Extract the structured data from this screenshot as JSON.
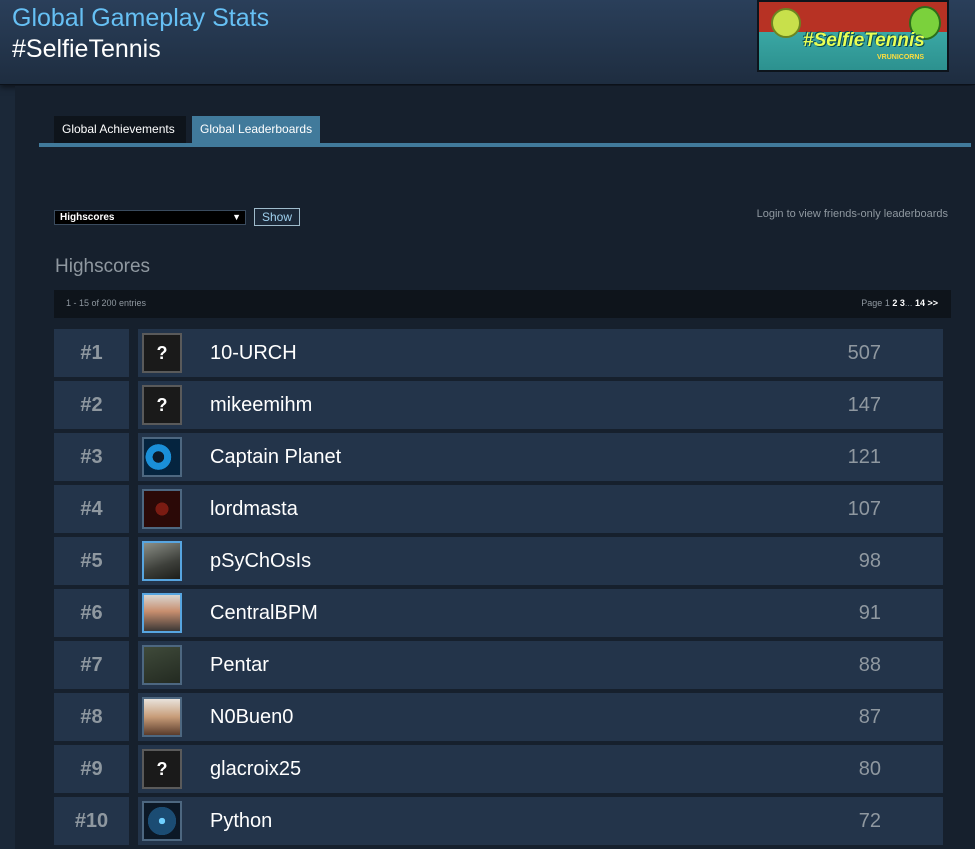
{
  "header": {
    "title": "Global Gameplay Stats",
    "subtitle": "#SelfieTennis",
    "banner": {
      "logo_text": "#SelfieTennis",
      "logo_small": "VRUNICORNS"
    }
  },
  "tabs": [
    {
      "label": "Global Achievements",
      "active": false
    },
    {
      "label": "Global Leaderboards",
      "active": true
    }
  ],
  "controls": {
    "leaderboard_select": "Highscores",
    "show_label": "Show",
    "login_note": "Login to view friends-only leaderboards"
  },
  "leaderboard": {
    "title": "Highscores",
    "entries_text": "1 - 15 of 200 entries",
    "paging": {
      "prefix": "Page",
      "current": "1",
      "pages": [
        "2",
        "3"
      ],
      "ellipsis": "...",
      "last": "14",
      "next": ">>"
    },
    "rows": [
      {
        "rank": "#1",
        "name": "10-URCH",
        "score": "507",
        "avatar": "question-mark-icon"
      },
      {
        "rank": "#2",
        "name": "mikeemihm",
        "score": "147",
        "avatar": "question-mark-icon"
      },
      {
        "rank": "#3",
        "name": "Captain Planet",
        "score": "121",
        "avatar": "planet-avatar"
      },
      {
        "rank": "#4",
        "name": "lordmasta",
        "score": "107",
        "avatar": "lordmasta-avatar"
      },
      {
        "rank": "#5",
        "name": "pSyChOsIs",
        "score": "98",
        "avatar": "psychosis-avatar"
      },
      {
        "rank": "#6",
        "name": "CentralBPM",
        "score": "91",
        "avatar": "centralbpm-avatar"
      },
      {
        "rank": "#7",
        "name": "Pentar",
        "score": "88",
        "avatar": "pentar-avatar"
      },
      {
        "rank": "#8",
        "name": "N0Buen0",
        "score": "87",
        "avatar": "n0buen0-avatar"
      },
      {
        "rank": "#9",
        "name": "glacroix25",
        "score": "80",
        "avatar": "question-mark-icon"
      },
      {
        "rank": "#10",
        "name": "Python",
        "score": "72",
        "avatar": "python-avatar"
      }
    ]
  },
  "colors": {
    "accent": "#66c0f4",
    "tab_active": "#417a9b",
    "row_bg": "#23344a",
    "page_bg": "#1b2838"
  }
}
